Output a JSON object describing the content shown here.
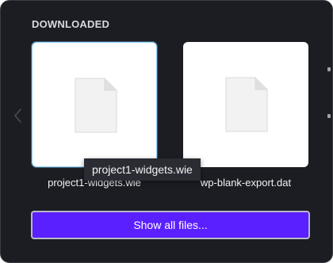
{
  "downloads": {
    "section_title": "DOWNLOADED",
    "files": [
      {
        "name": "project1-widgets.wie",
        "icon": "file-icon"
      },
      {
        "name": "wp-blank-export.dat",
        "icon": "file-icon"
      }
    ],
    "tooltip": "project1-widgets.wie",
    "show_all_label": "Show all files..."
  },
  "colors": {
    "panel_background": "#1c1d23",
    "accent_button": "#5b20ff",
    "selected_card_border": "#8fd3ff"
  }
}
